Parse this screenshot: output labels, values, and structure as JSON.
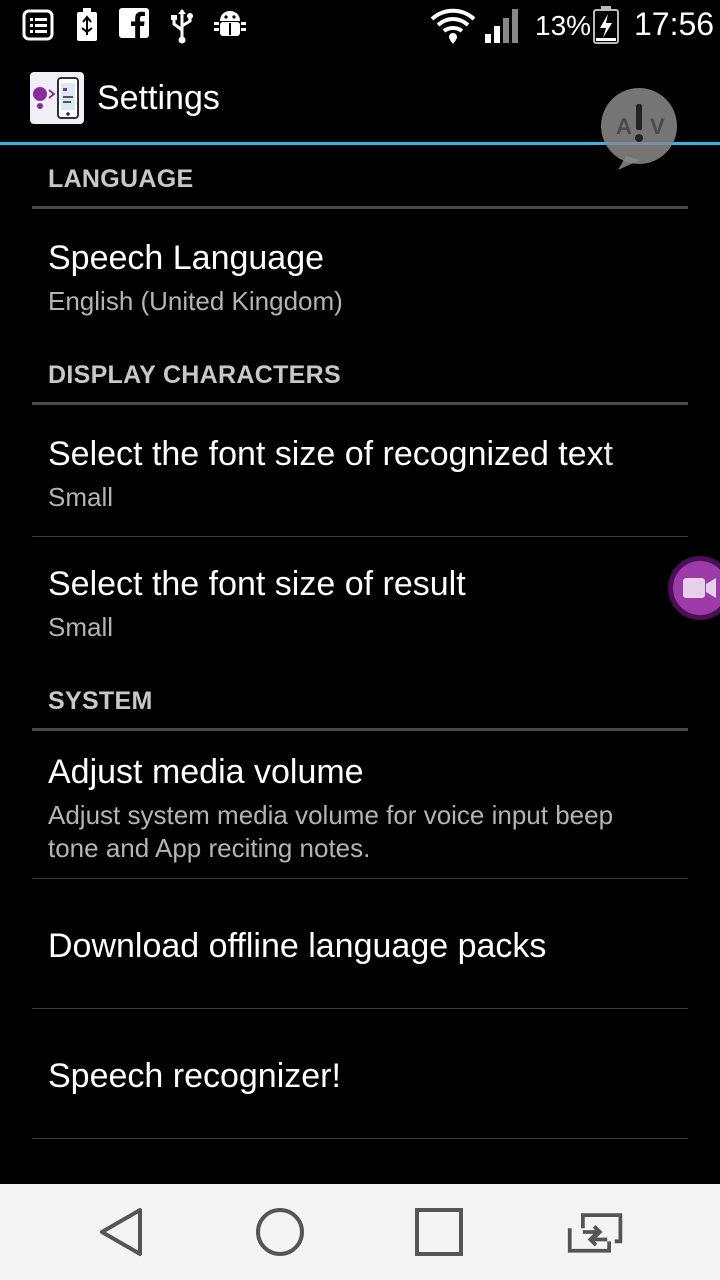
{
  "status_bar": {
    "icons": [
      "notes-icon",
      "usb-battery-icon",
      "facebook-icon",
      "usb-icon",
      "android-debug-icon",
      "wifi-icon",
      "signal-icon",
      "battery-charging-icon"
    ],
    "battery_percent": "13%",
    "time": "17:56"
  },
  "action_bar": {
    "title": "Settings",
    "accent_color": "#33b5e5"
  },
  "floating_bubble": {
    "letters": "A ! V"
  },
  "sections": {
    "language": {
      "header": "LANGUAGE",
      "speech_language": {
        "title": "Speech Language",
        "summary": "English (United Kingdom)"
      }
    },
    "display": {
      "header": "DISPLAY CHARACTERS",
      "recognized_font": {
        "title": "Select the font size of recognized text",
        "summary": "Small"
      },
      "result_font": {
        "title": "Select the font size of result",
        "summary": "Small"
      }
    },
    "system": {
      "header": "SYSTEM",
      "media_volume": {
        "title": "Adjust media volume",
        "summary": "Adjust system media volume for voice input beep tone and App reciting notes."
      },
      "offline_packs": {
        "title": "Download offline language packs"
      },
      "speech_recognizer": {
        "title": "Speech recognizer!"
      }
    }
  },
  "nav_bar": {
    "buttons": [
      "back-icon",
      "home-icon",
      "recents-icon",
      "switch-sim-icon"
    ]
  }
}
